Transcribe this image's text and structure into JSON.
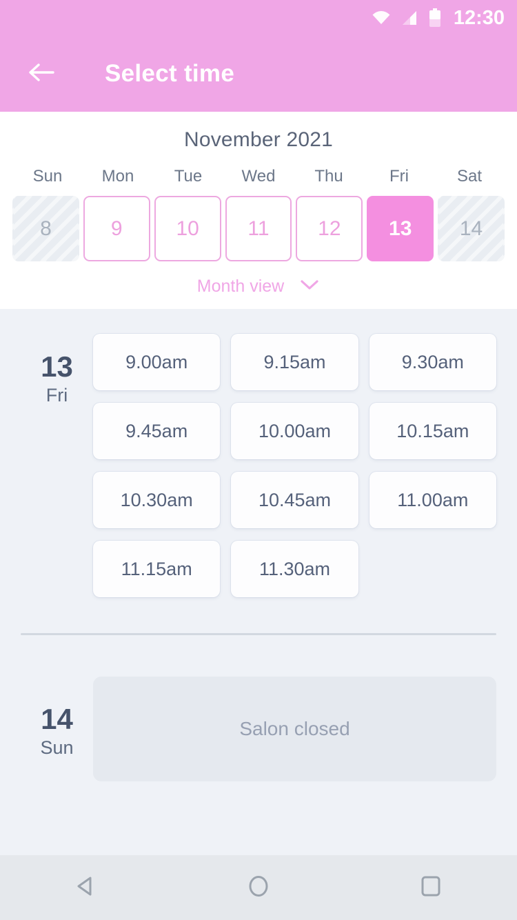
{
  "status_bar": {
    "time": "12:30",
    "icons": [
      "wifi-icon",
      "signal-icon",
      "battery-icon"
    ]
  },
  "app_bar": {
    "back_icon": "back-arrow-icon",
    "title": "Select time"
  },
  "calendar": {
    "month_title": "November 2021",
    "weekdays": [
      "Sun",
      "Mon",
      "Tue",
      "Wed",
      "Thu",
      "Fri",
      "Sat"
    ],
    "days": [
      {
        "number": "8",
        "state": "disabled"
      },
      {
        "number": "9",
        "state": "enabled"
      },
      {
        "number": "10",
        "state": "enabled"
      },
      {
        "number": "11",
        "state": "enabled"
      },
      {
        "number": "12",
        "state": "enabled"
      },
      {
        "number": "13",
        "state": "selected"
      },
      {
        "number": "14",
        "state": "disabled"
      }
    ],
    "month_view_label": "Month view",
    "month_view_icon": "chevron-down-icon"
  },
  "schedule": [
    {
      "day_number": "13",
      "day_of_week": "Fri",
      "slots": [
        "9.00am",
        "9.15am",
        "9.30am",
        "9.45am",
        "10.00am",
        "10.15am",
        "10.30am",
        "10.45am",
        "11.00am",
        "11.15am",
        "11.30am"
      ]
    },
    {
      "day_number": "14",
      "day_of_week": "Sun",
      "closed_message": "Salon closed"
    }
  ],
  "nav_bar": {
    "back": "nav-back-icon",
    "home": "nav-home-icon",
    "recents": "nav-recents-icon"
  },
  "colors": {
    "accent_pink": "#F0A6E6",
    "selected_pink": "#F48FE0",
    "border_pink": "#EDA8E0",
    "body_bg": "#EFF2F7",
    "text_dark": "#46536B"
  }
}
